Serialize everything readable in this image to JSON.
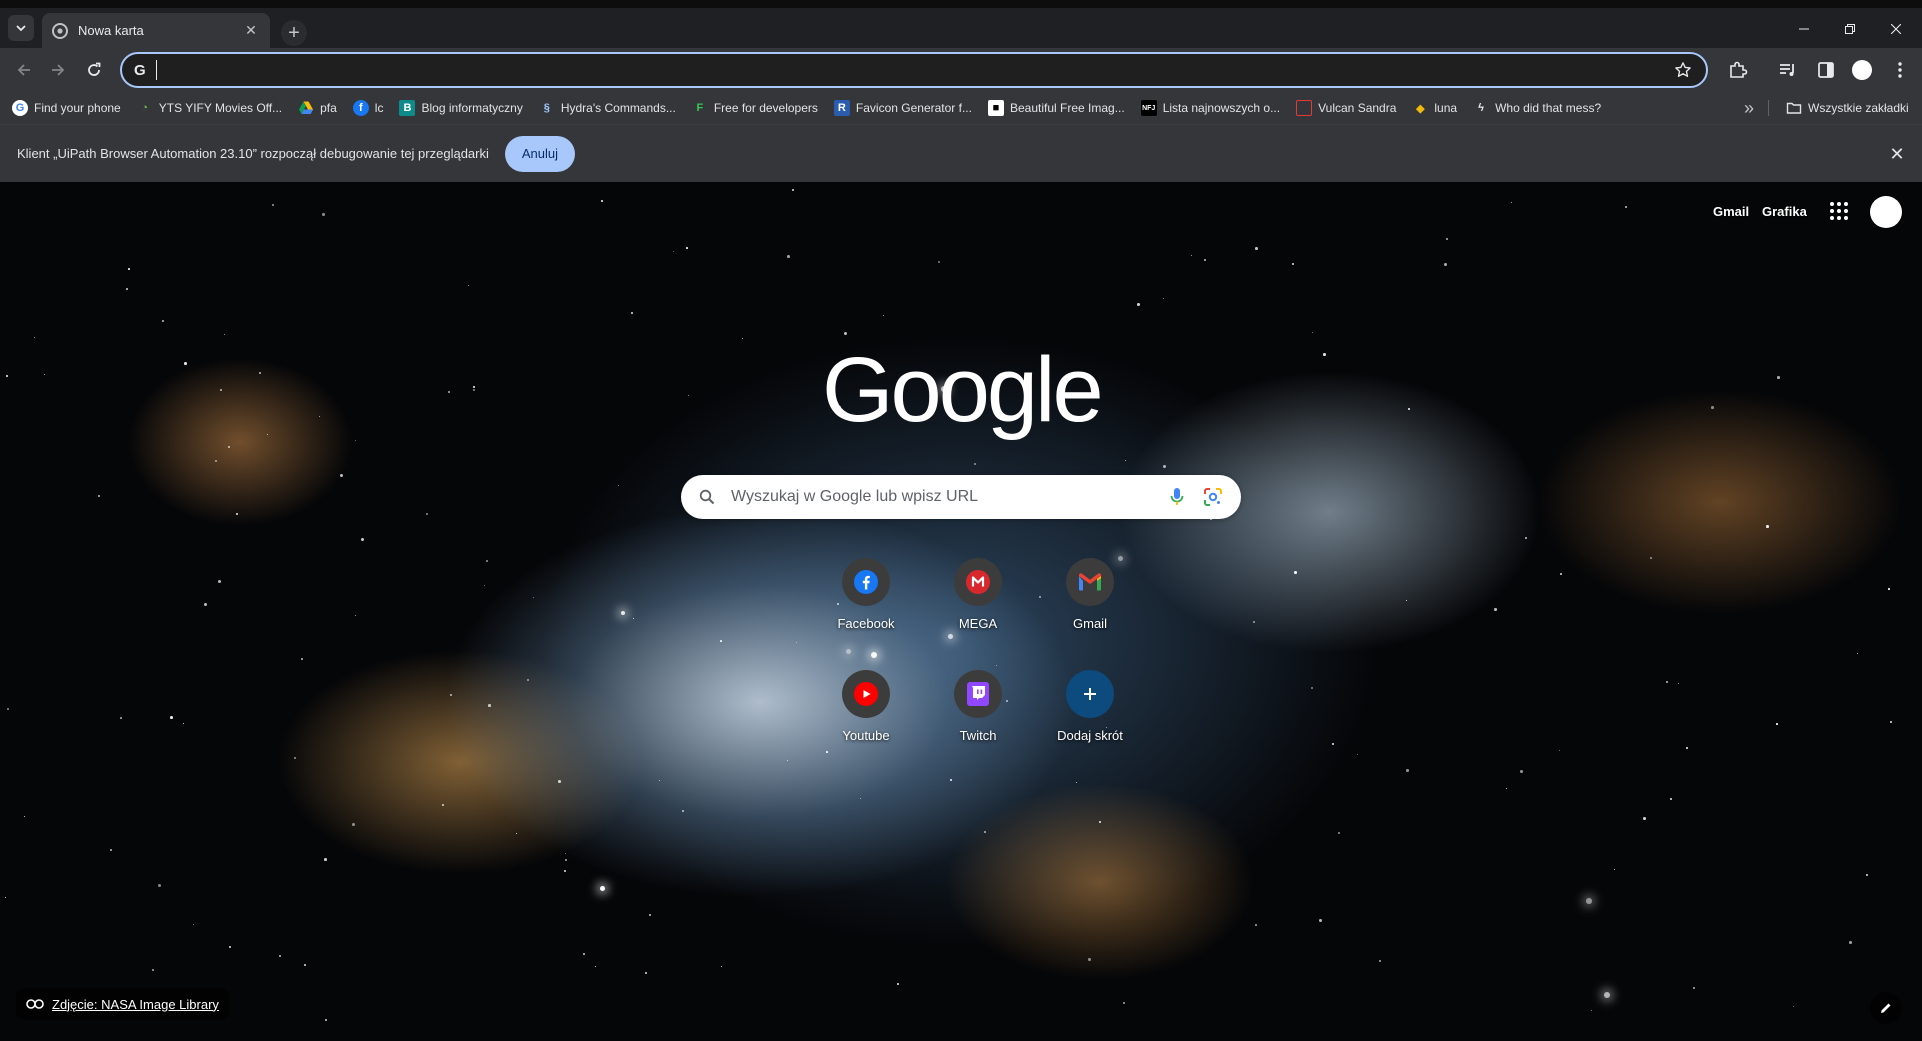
{
  "tab": {
    "title": "Nowa karta",
    "close_symbol": "✕"
  },
  "new_tab_symbol": "+",
  "omnibox": {
    "prefix": "G",
    "value": "",
    "placeholder": ""
  },
  "bookmarks": [
    {
      "label": "Find your phone",
      "icon": "google-g-icon"
    },
    {
      "label": "YTS YIFY Movies Off...",
      "icon": "yts-icon"
    },
    {
      "label": "pfa",
      "icon": "google-drive-icon"
    },
    {
      "label": "lc",
      "icon": "facebook-icon"
    },
    {
      "label": "Blog informatyczny",
      "icon": "blog-icon"
    },
    {
      "label": "Hydra's Commands...",
      "icon": "hydra-icon"
    },
    {
      "label": "Free for developers",
      "icon": "ffd-icon"
    },
    {
      "label": "Favicon Generator f...",
      "icon": "favicon-generator-icon"
    },
    {
      "label": "Beautiful Free Imag...",
      "icon": "unsplash-icon"
    },
    {
      "label": "Lista najnowszych o...",
      "icon": "nfj-icon"
    },
    {
      "label": "Vulcan Sandra",
      "icon": "vulcan-icon"
    },
    {
      "label": "luna",
      "icon": "binance-icon"
    },
    {
      "label": "Who did that mess?",
      "icon": "lightning-icon"
    }
  ],
  "bookmarks_more_symbol": "»",
  "all_bookmarks_label": "Wszystkie zakładki",
  "infobar": {
    "message": "Klient „UiPath Browser Automation 23.10” rozpoczął debugowanie tej przeglądarki",
    "button_label": "Anuluj",
    "close_symbol": "✕"
  },
  "ntp": {
    "gmail_link": "Gmail",
    "images_link": "Grafika",
    "logo_text": "Google",
    "search_placeholder": "Wyszukaj w Google lub wpisz URL",
    "shortcuts": [
      {
        "label": "Facebook",
        "icon": "facebook-icon",
        "color": "#1877f2"
      },
      {
        "label": "MEGA",
        "icon": "mega-icon",
        "color": "#d9272e"
      },
      {
        "label": "Gmail",
        "icon": "gmail-icon",
        "color": "#ea4335"
      },
      {
        "label": "Youtube",
        "icon": "youtube-icon",
        "color": "#ff0000"
      },
      {
        "label": "Twitch",
        "icon": "twitch-icon",
        "color": "#9146ff"
      },
      {
        "label": "Dodaj skrót",
        "icon": "plus-icon",
        "color": "#0b57d0"
      }
    ],
    "attribution": "Zdjęcie: NASA Image Library"
  },
  "colors": {
    "accent": "#a8c7fa",
    "toolbar": "#35363a",
    "tabstrip": "#1f2023"
  }
}
